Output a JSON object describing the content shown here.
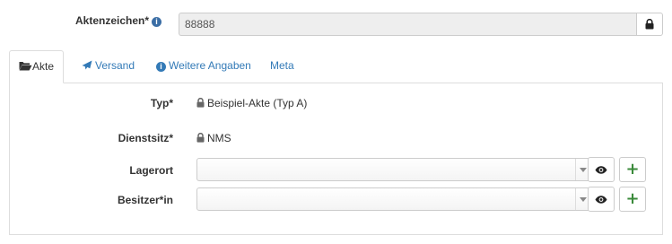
{
  "aktenzeichen": {
    "label": "Aktenzeichen*",
    "value": "88888"
  },
  "tabs": [
    {
      "label": "Akte",
      "icon": "folder-open-icon",
      "active": true
    },
    {
      "label": "Versand",
      "icon": "paper-plane-icon",
      "active": false
    },
    {
      "label": "Weitere Angaben",
      "icon": "info-circle-icon",
      "active": false
    },
    {
      "label": "Meta",
      "icon": "",
      "active": false
    }
  ],
  "fields": {
    "typ": {
      "label": "Typ",
      "value": "Beispiel-Akte (Typ A)"
    },
    "dienstsitz": {
      "label": "Dienstsitz",
      "value": "NMS"
    },
    "lagerort": {
      "label": "Lagerort",
      "value": ""
    },
    "besitzer": {
      "label": "Besitzer*in",
      "value": ""
    }
  },
  "required_marker": "*",
  "colors": {
    "link": "#337ab7",
    "add_green": "#3a8a3a",
    "info_blue": "#3b6ea5"
  }
}
